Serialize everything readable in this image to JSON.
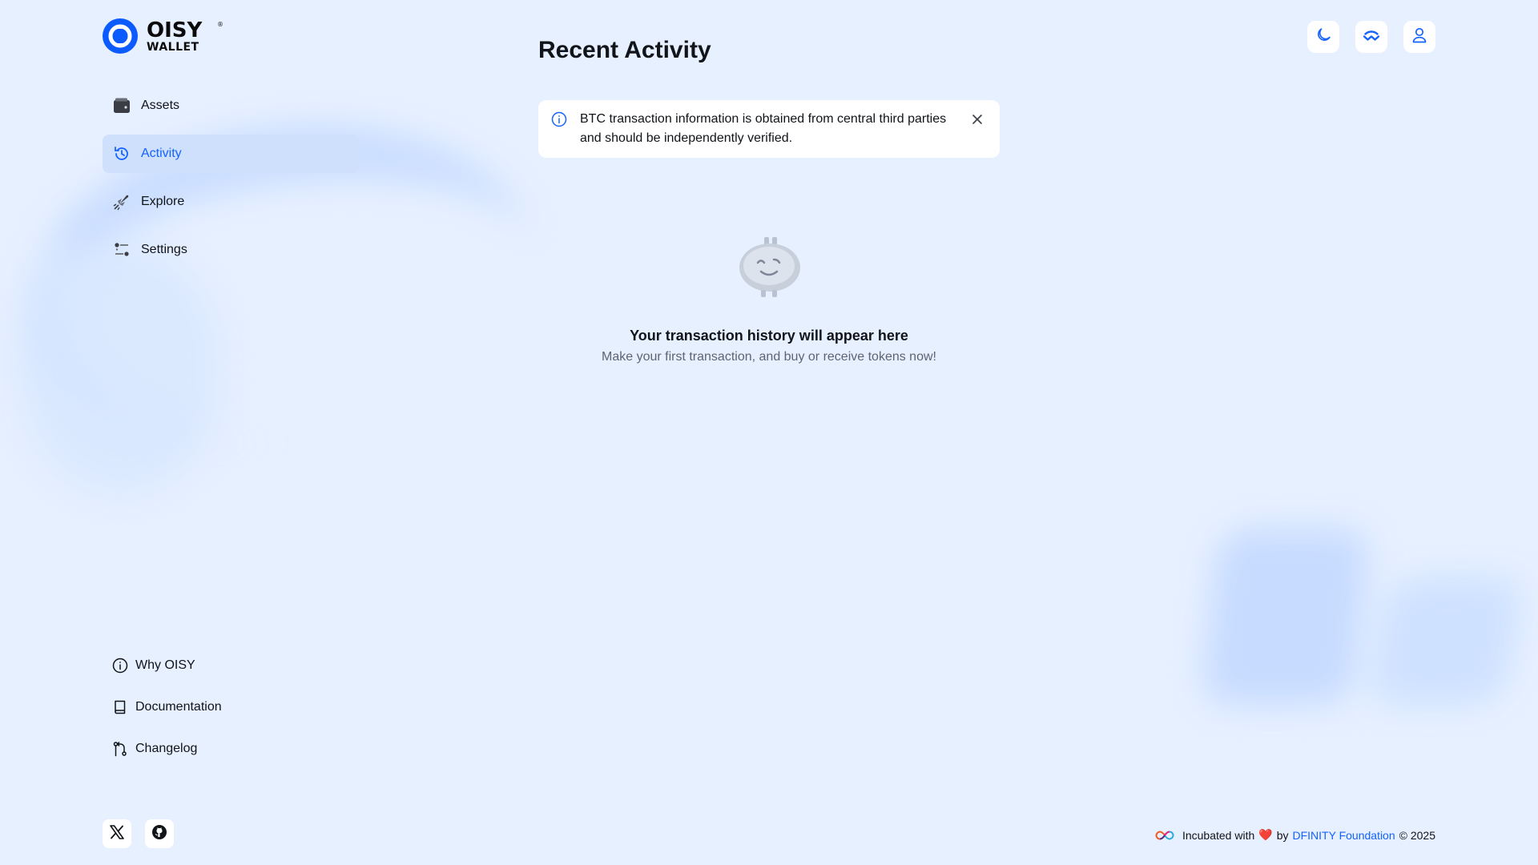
{
  "brand": {
    "word1": "OISY",
    "word2": "WALLET",
    "registered": "®",
    "accent_color": "#0c5bff"
  },
  "sidebar": {
    "items": [
      {
        "label": "Assets",
        "icon": "wallet-icon"
      },
      {
        "label": "Activity",
        "icon": "history-icon",
        "active": true
      },
      {
        "label": "Explore",
        "icon": "rocket-icon"
      },
      {
        "label": "Settings",
        "icon": "settings-sliders-icon"
      }
    ],
    "links": [
      {
        "label": "Why OISY",
        "icon": "info-icon"
      },
      {
        "label": "Documentation",
        "icon": "book-icon"
      },
      {
        "label": "Changelog",
        "icon": "git-branch-icon"
      }
    ],
    "socials": [
      {
        "icon": "x-logo-icon"
      },
      {
        "icon": "github-icon"
      }
    ]
  },
  "header": {
    "buttons": [
      {
        "icon": "moon-icon"
      },
      {
        "icon": "walletconnect-icon"
      },
      {
        "icon": "user-icon"
      }
    ]
  },
  "main": {
    "title": "Recent Activity",
    "banner": {
      "icon": "info-circle-icon",
      "text": "BTC transaction information is obtained from central third parties and should be independently verified."
    },
    "empty_state": {
      "title": "Your transaction history will appear here",
      "subtitle": "Make your first transaction, and buy or receive tokens now!"
    }
  },
  "footer": {
    "prefix": "Incubated with",
    "heart": "❤️",
    "by": "by",
    "link_text": "DFINITY Foundation",
    "suffix": "© 2025",
    "link_color": "#1463ff"
  }
}
